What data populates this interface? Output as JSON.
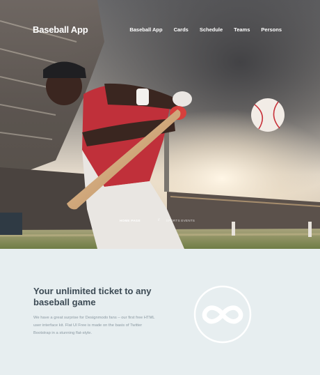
{
  "brand": "Baseball App",
  "nav": [
    {
      "label": "Baseball App"
    },
    {
      "label": "Cards"
    },
    {
      "label": "Schedule"
    },
    {
      "label": "Teams"
    },
    {
      "label": "Persons"
    }
  ],
  "hero": {
    "links": [
      "HOME PAGE",
      "//",
      "SPORTS EVENTS"
    ]
  },
  "feature": {
    "title": "Your unlimited ticket to any baseball game",
    "text": "We have a great surprise for Designmodo fans – our first free HTML user interface kit. Flat UI Free is made on the basis of Twitter Bootstrap in a stunning flat-style.",
    "icon": "infinity-icon"
  },
  "colors": {
    "section_bg": "#e7eef0",
    "title": "#3c4a54",
    "body_text": "#8b99a2",
    "hero_text": "#ffffff"
  }
}
